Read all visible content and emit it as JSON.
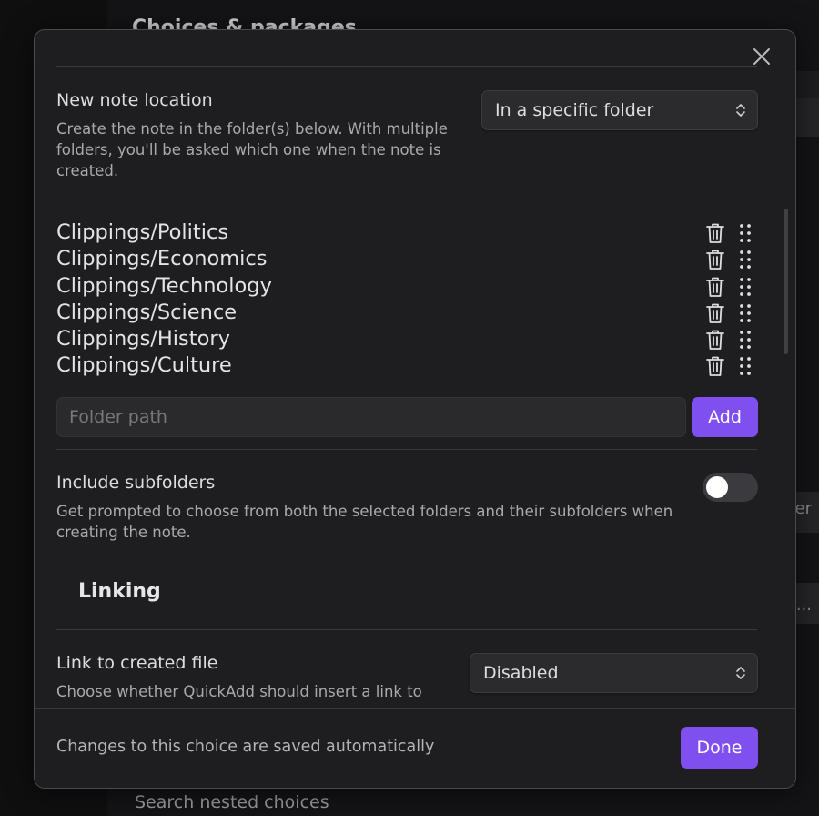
{
  "background": {
    "title": "Choices & packages",
    "edge_text_1": "er",
    "edge_text_2": "e...",
    "search_label": "Search nested choices"
  },
  "modal": {
    "new_note_location": {
      "name": "New note location",
      "description": "Create the note in the folder(s) below. With multiple folders, you'll be asked which one when the note is created.",
      "selected": "In a specific folder"
    },
    "folders": [
      "Clippings/Politics",
      "Clippings/Economics",
      "Clippings/Technology",
      "Clippings/Science",
      "Clippings/History",
      "Clippings/Culture"
    ],
    "folder_input": {
      "value": "",
      "placeholder": "Folder path"
    },
    "add_label": "Add",
    "include_subfolders": {
      "name": "Include subfolders",
      "description": "Get prompted to choose from both the selected folders and their subfolders when creating the note.",
      "enabled": false
    },
    "linking_heading": "Linking",
    "link_to_created_file": {
      "name": "Link to created file",
      "description": "Choose whether QuickAdd should insert a link to",
      "selected": "Disabled"
    },
    "footer": {
      "text": "Changes to this choice are saved automatically",
      "done_label": "Done"
    }
  },
  "colors": {
    "accent": "#7f4ff0",
    "modal_bg": "#1e1e20",
    "text": "#dcddde",
    "muted_text": "#a9a9ae"
  }
}
